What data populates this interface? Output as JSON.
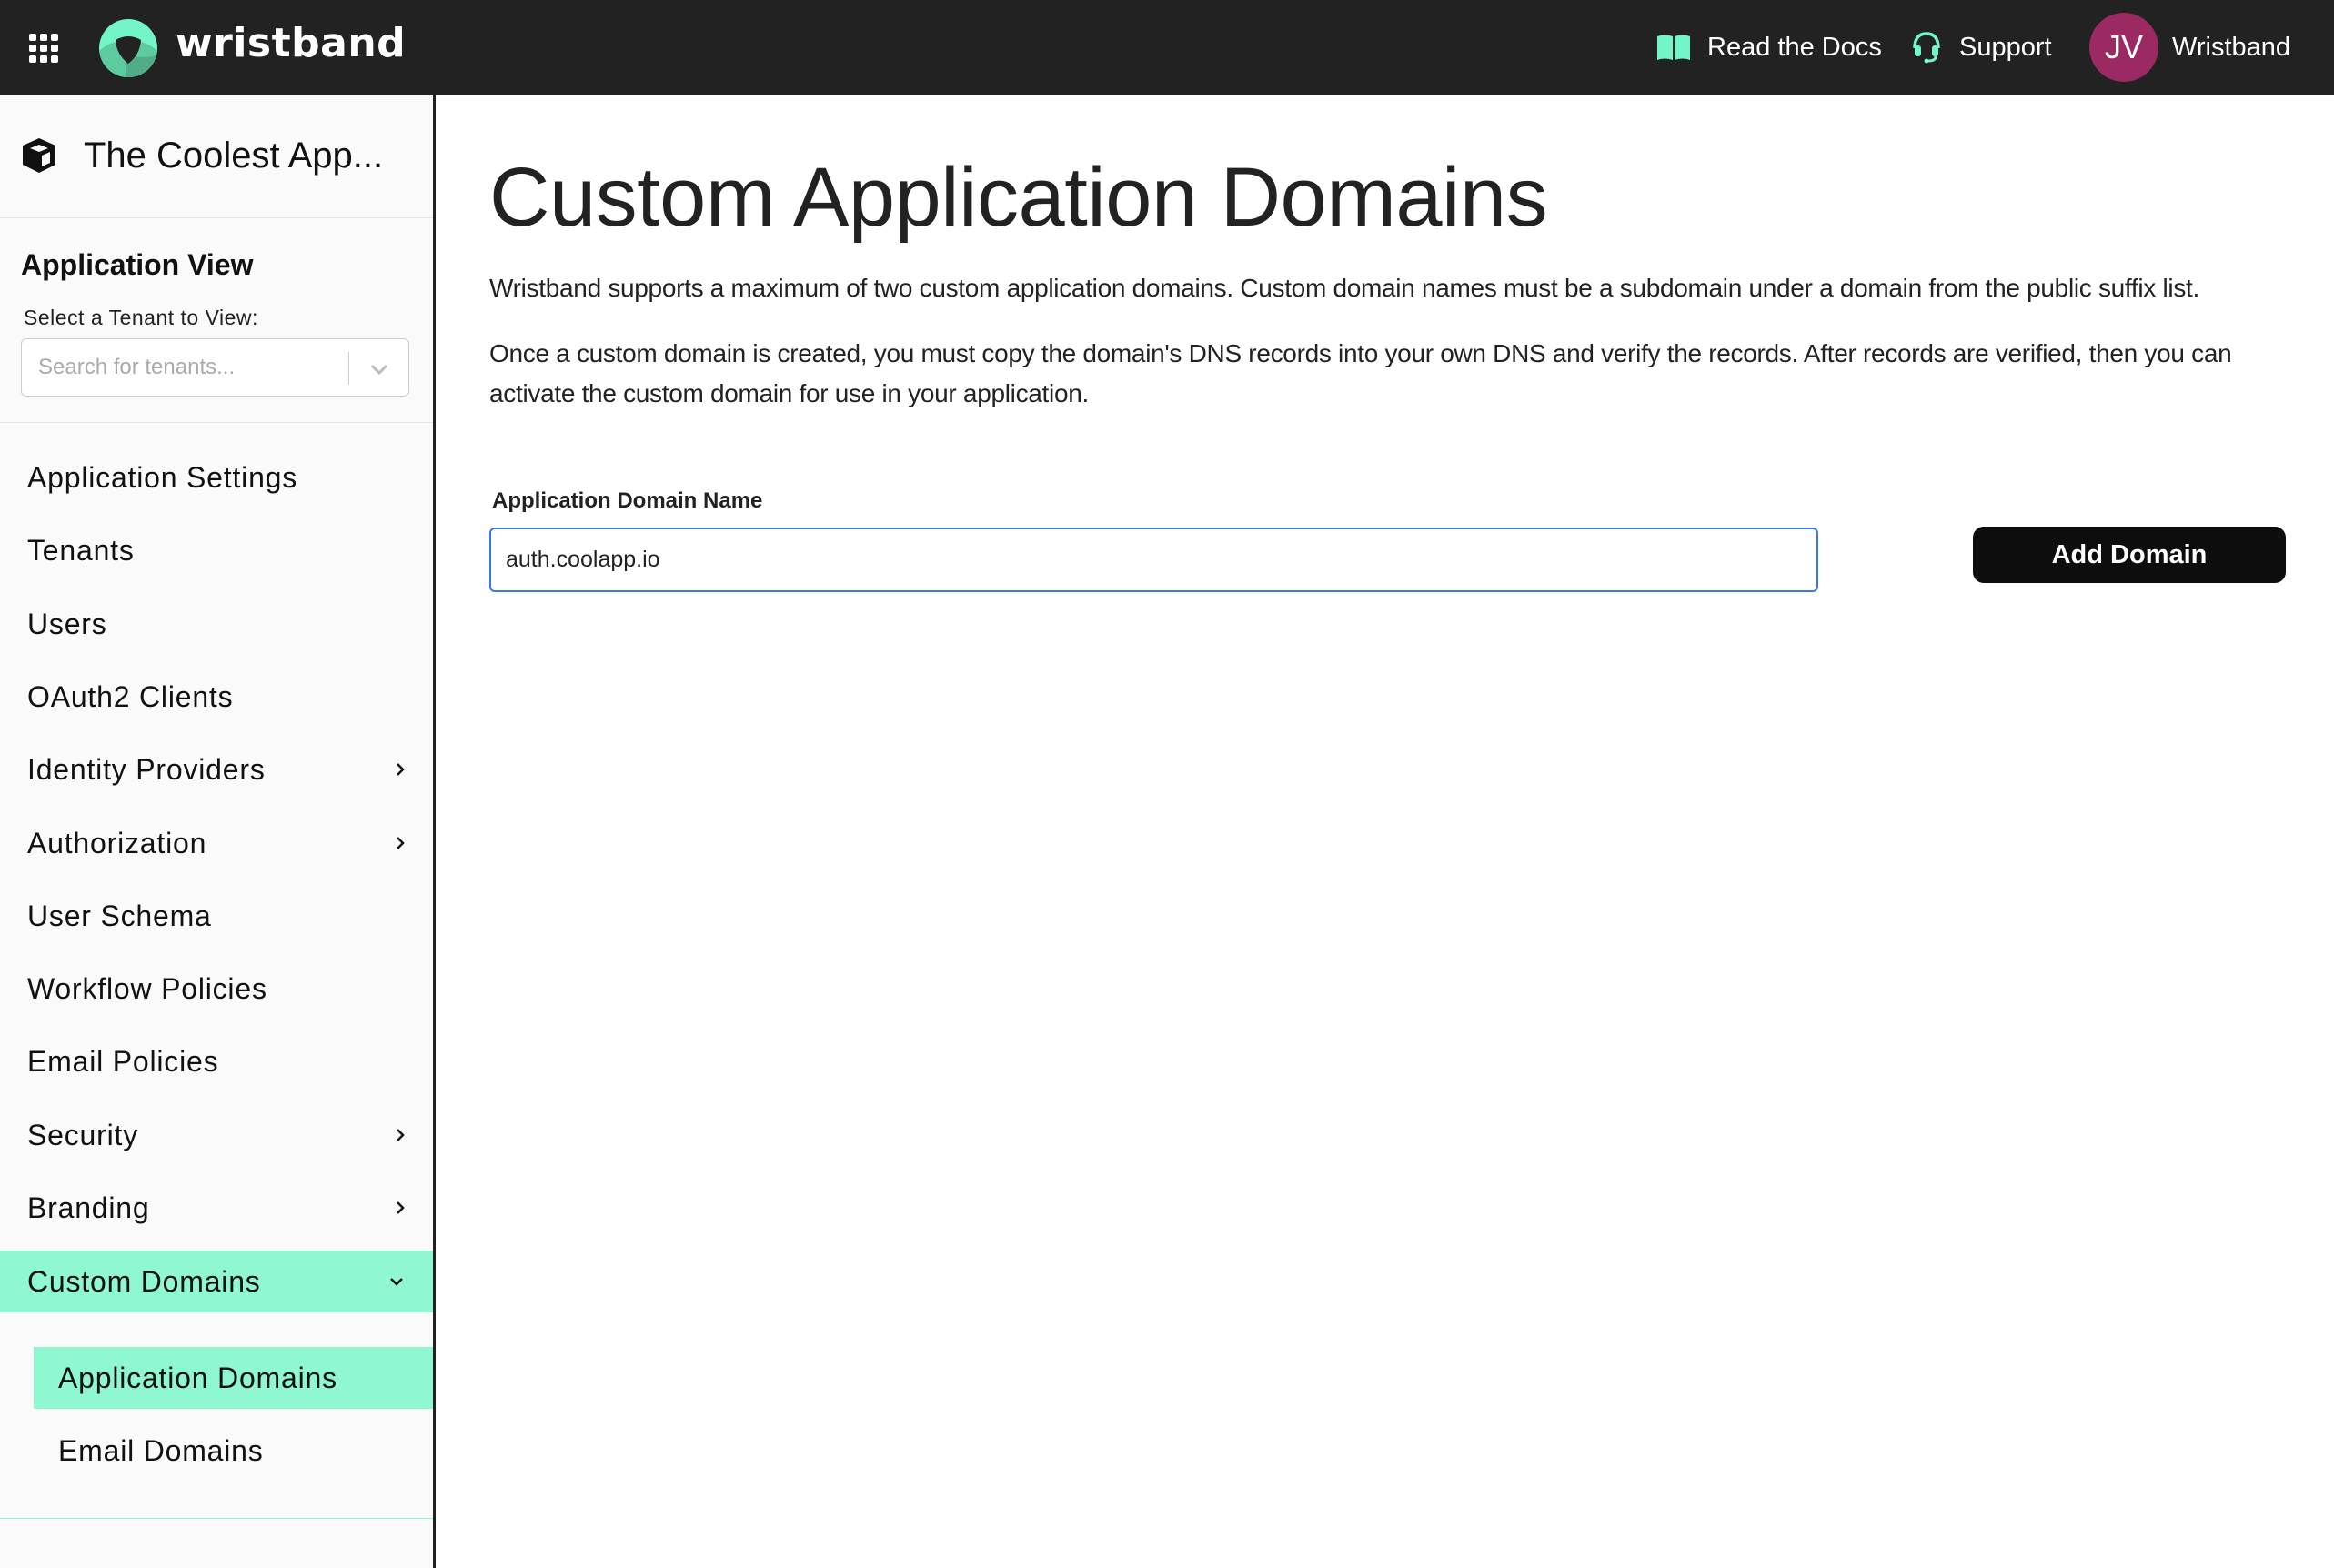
{
  "topbar": {
    "brand": "wristband",
    "links": [
      {
        "label": "Read the Docs",
        "icon": "book-icon"
      },
      {
        "label": "Support",
        "icon": "headset-icon"
      }
    ],
    "user": {
      "initials": "JV",
      "name": "Wristband",
      "avatar_color": "#9c2a62"
    },
    "accent": "#74f5c8"
  },
  "sidebar": {
    "app_name": "The Coolest App...",
    "view_title": "Application View",
    "tenant_label": "Select a Tenant to View:",
    "tenant_placeholder": "Search for tenants...",
    "items": [
      {
        "label": "Application Settings",
        "chevron": false
      },
      {
        "label": "Tenants",
        "chevron": false
      },
      {
        "label": "Users",
        "chevron": false
      },
      {
        "label": "OAuth2 Clients",
        "chevron": false
      },
      {
        "label": "Identity Providers",
        "chevron": "right"
      },
      {
        "label": "Authorization",
        "chevron": "right"
      },
      {
        "label": "User Schema",
        "chevron": false
      },
      {
        "label": "Workflow Policies",
        "chevron": false
      },
      {
        "label": "Email Policies",
        "chevron": false
      },
      {
        "label": "Security",
        "chevron": "right"
      },
      {
        "label": "Branding",
        "chevron": "right"
      },
      {
        "label": "Custom Domains",
        "chevron": "down",
        "active": true
      }
    ],
    "sub_items": [
      {
        "label": "Application Domains",
        "active": true
      },
      {
        "label": "Email Domains",
        "active": false
      }
    ],
    "highlight_color": "#8ff8d0"
  },
  "main": {
    "title": "Custom Application Domains",
    "paragraph1": "Wristband supports a maximum of two custom application domains. Custom domain names must be a subdomain under a domain from the public suffix list.",
    "paragraph2": "Once a custom domain is created, you must copy the domain's DNS records into your own DNS and verify the records. After records are verified, then you can activate the custom domain for use in your application.",
    "field_label": "Application Domain Name",
    "field_value": "auth.coolapp.io",
    "add_button": "Add Domain"
  }
}
